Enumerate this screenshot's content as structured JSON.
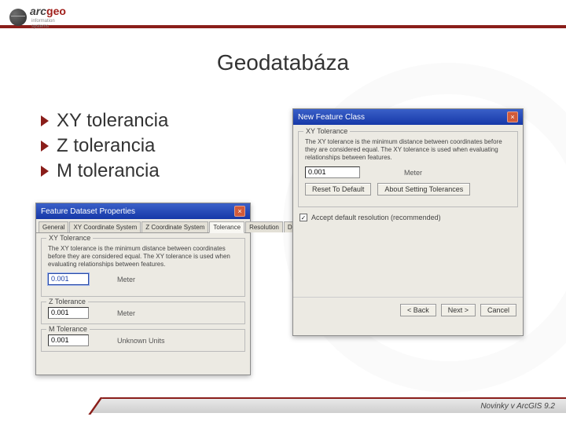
{
  "brand": {
    "name_pre": "arc",
    "name_post": "geo",
    "sub1": "information",
    "sub2": "systems"
  },
  "title": "Geodatabáza",
  "bullets": [
    "XY tolerancia",
    "Z tolerancia",
    "M tolerancia"
  ],
  "dlg1": {
    "title": "Feature Dataset Properties",
    "tabs": [
      "General",
      "XY Coordinate System",
      "Z Coordinate System",
      "Tolerance",
      "Resolution",
      "Domain"
    ],
    "active_tab": "Tolerance",
    "xy_group": "XY Tolerance",
    "xy_desc": "The XY tolerance is the minimum distance between coordinates before they are considered equal. The XY tolerance is used when evaluating relationships between features.",
    "xy_value": "0.001",
    "xy_unit": "Meter",
    "z_group": "Z Tolerance",
    "z_value": "0.001",
    "z_unit": "Meter",
    "m_group": "M Tolerance",
    "m_value": "0.001",
    "m_unit": "Unknown Units"
  },
  "dlg2": {
    "title": "New Feature Class",
    "group": "XY Tolerance",
    "desc": "The XY tolerance is the minimum distance between coordinates before they are considered equal. The XY tolerance is used when evaluating relationships between features.",
    "value": "0.001",
    "unit": "Meter",
    "reset_btn": "Reset To Default",
    "about_btn": "About Setting Tolerances",
    "checkbox_checked": "✓",
    "checkbox_label": "Accept default resolution (recommended)",
    "back": "< Back",
    "next": "Next >",
    "cancel": "Cancel"
  },
  "footer": "Novinky v ArcGIS 9.2"
}
